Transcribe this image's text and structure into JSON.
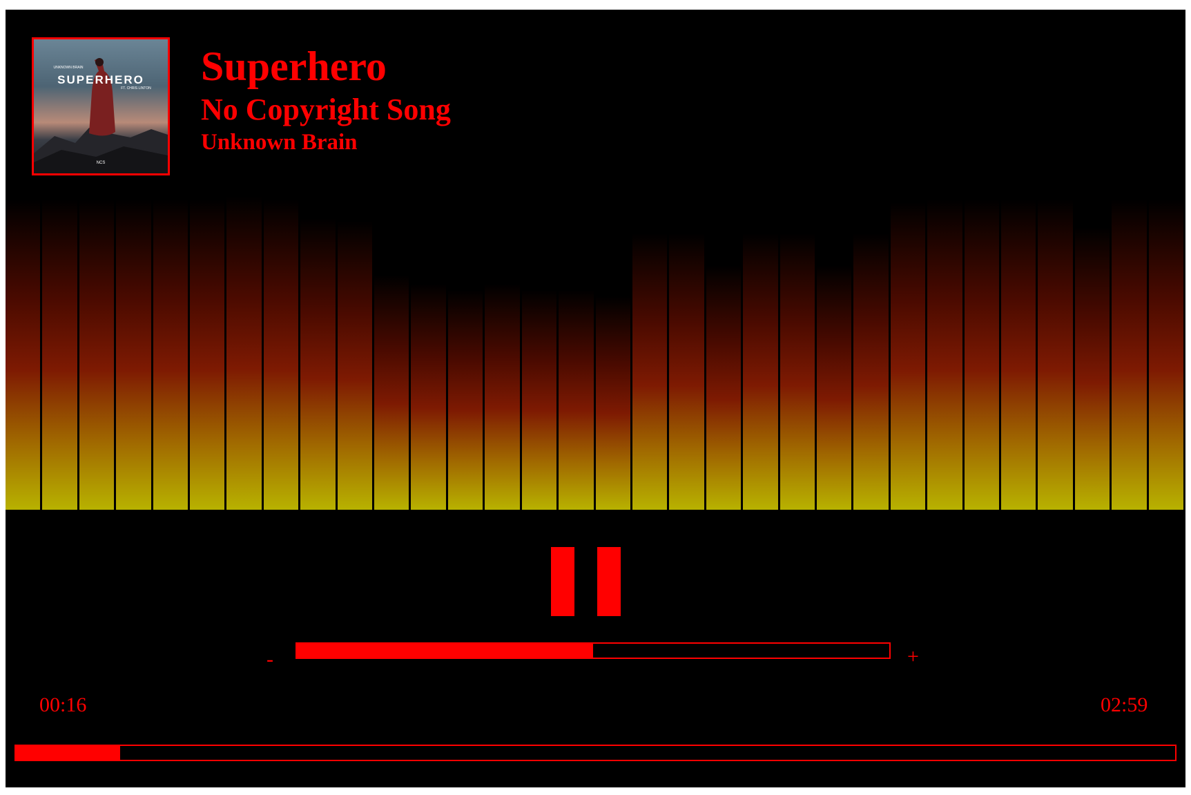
{
  "track": {
    "title": "Superhero",
    "subtitle": "No Copyright Song",
    "artist": "Unknown Brain",
    "cover_text": {
      "top": "UNKNOWN BRAIN",
      "main": "SUPERHERO",
      "feat": "FT. CHRIS LINTON",
      "logo": "NCS"
    }
  },
  "controls": {
    "state": "playing",
    "pause_icon": "pause-icon",
    "volume_minus": "-",
    "volume_plus": "+",
    "volume_level": 0.5
  },
  "time": {
    "current": "00:16",
    "duration": "02:59",
    "progress": 0.09
  },
  "visualizer": {
    "levels": [
      0.99,
      0.99,
      0.99,
      0.99,
      0.99,
      0.99,
      1.0,
      0.99,
      0.93,
      0.92,
      0.75,
      0.72,
      0.7,
      0.72,
      0.7,
      0.7,
      0.68,
      0.88,
      0.88,
      0.78,
      0.88,
      0.88,
      0.78,
      0.88,
      0.98,
      0.99,
      0.99,
      0.99,
      0.99,
      0.9,
      0.99,
      0.99
    ],
    "colors": [
      "#b8b200",
      "#a06800",
      "#7e1a02",
      "#4a0a00",
      "#000000"
    ]
  },
  "colors": {
    "accent": "#ff0000",
    "background": "#000000"
  }
}
